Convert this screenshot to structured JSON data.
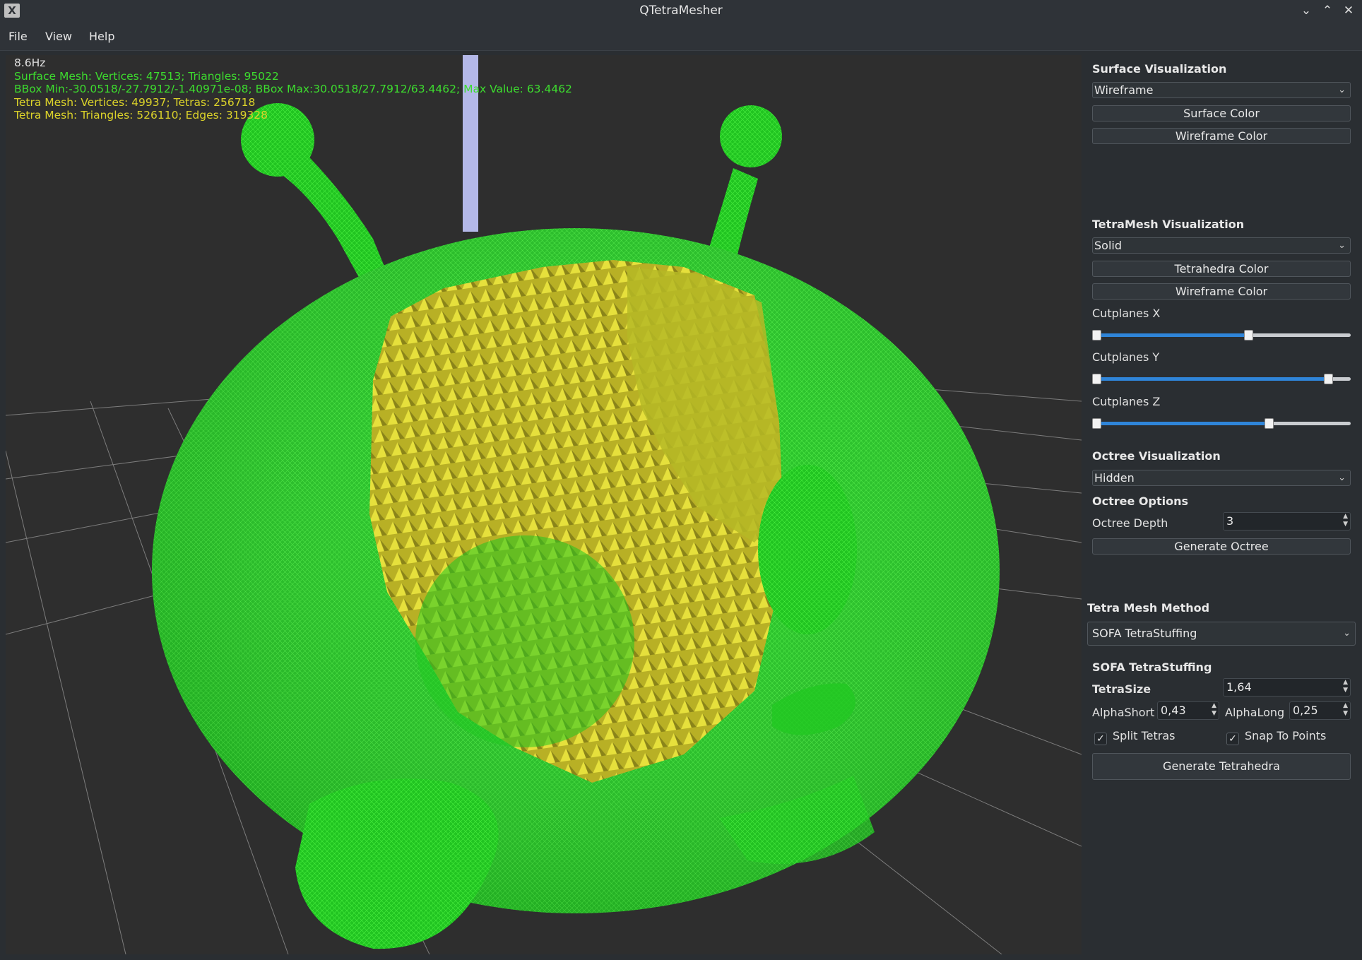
{
  "window": {
    "title": "QTetraMesher",
    "icon": "X"
  },
  "menu": [
    "File",
    "View",
    "Help"
  ],
  "hud": {
    "fps": "8.6Hz",
    "surface_mesh": "Surface Mesh: Vertices: 47513; Triangles: 95022",
    "bbox": "BBox Min:-30.0518/-27.7912/-1.40971e-08; BBox Max:30.0518/27.7912/63.4462; Max Value: 63.4462",
    "tetra_vertices": "Tetra Mesh: Vertices: 49937; Tetras: 256718",
    "tetra_triangles": "Tetra Mesh: Triangles: 526110; Edges: 319328"
  },
  "panel": {
    "surface": {
      "title": "Surface Visualization",
      "mode": "Wireframe",
      "surface_color": "Surface Color",
      "wireframe_color": "Wireframe Color"
    },
    "tetra": {
      "title": "TetraMesh Visualization",
      "mode": "Solid",
      "tetra_color": "Tetrahedra Color",
      "wireframe_color": "Wireframe Color",
      "cut_x": {
        "label": "Cutplanes X",
        "low": 0.0,
        "high": 0.61
      },
      "cut_y": {
        "label": "Cutplanes Y",
        "low": 0.0,
        "high": 0.93
      },
      "cut_z": {
        "label": "Cutplanes Z",
        "low": 0.0,
        "high": 0.69
      }
    },
    "octree": {
      "title": "Octree Visualization",
      "mode": "Hidden",
      "options_title": "Octree Options",
      "depth_label": "Octree Depth",
      "depth": "3",
      "generate": "Generate Octree"
    },
    "method": {
      "title": "Tetra Mesh Method",
      "value": "SOFA TetraStuffing"
    },
    "sofa": {
      "title": "SOFA TetraStuffing",
      "tetrasize_label": "TetraSize",
      "tetrasize": "1,64",
      "alpha_short_label": "AlphaShort",
      "alpha_short": "0,43",
      "alpha_long_label": "AlphaLong",
      "alpha_long": "0,25",
      "split_tetras": "Split Tetras",
      "snap_to_points": "Snap To Points",
      "generate": "Generate Tetrahedra"
    }
  },
  "colors": {
    "hud_white": "#e0e0e0",
    "hud_green": "#3ddc2e",
    "hud_yellow": "#dcd32a",
    "mesh_green": "#1fd41f",
    "tetra_yellow": "#c9c62a",
    "accent": "#2f85d9"
  }
}
